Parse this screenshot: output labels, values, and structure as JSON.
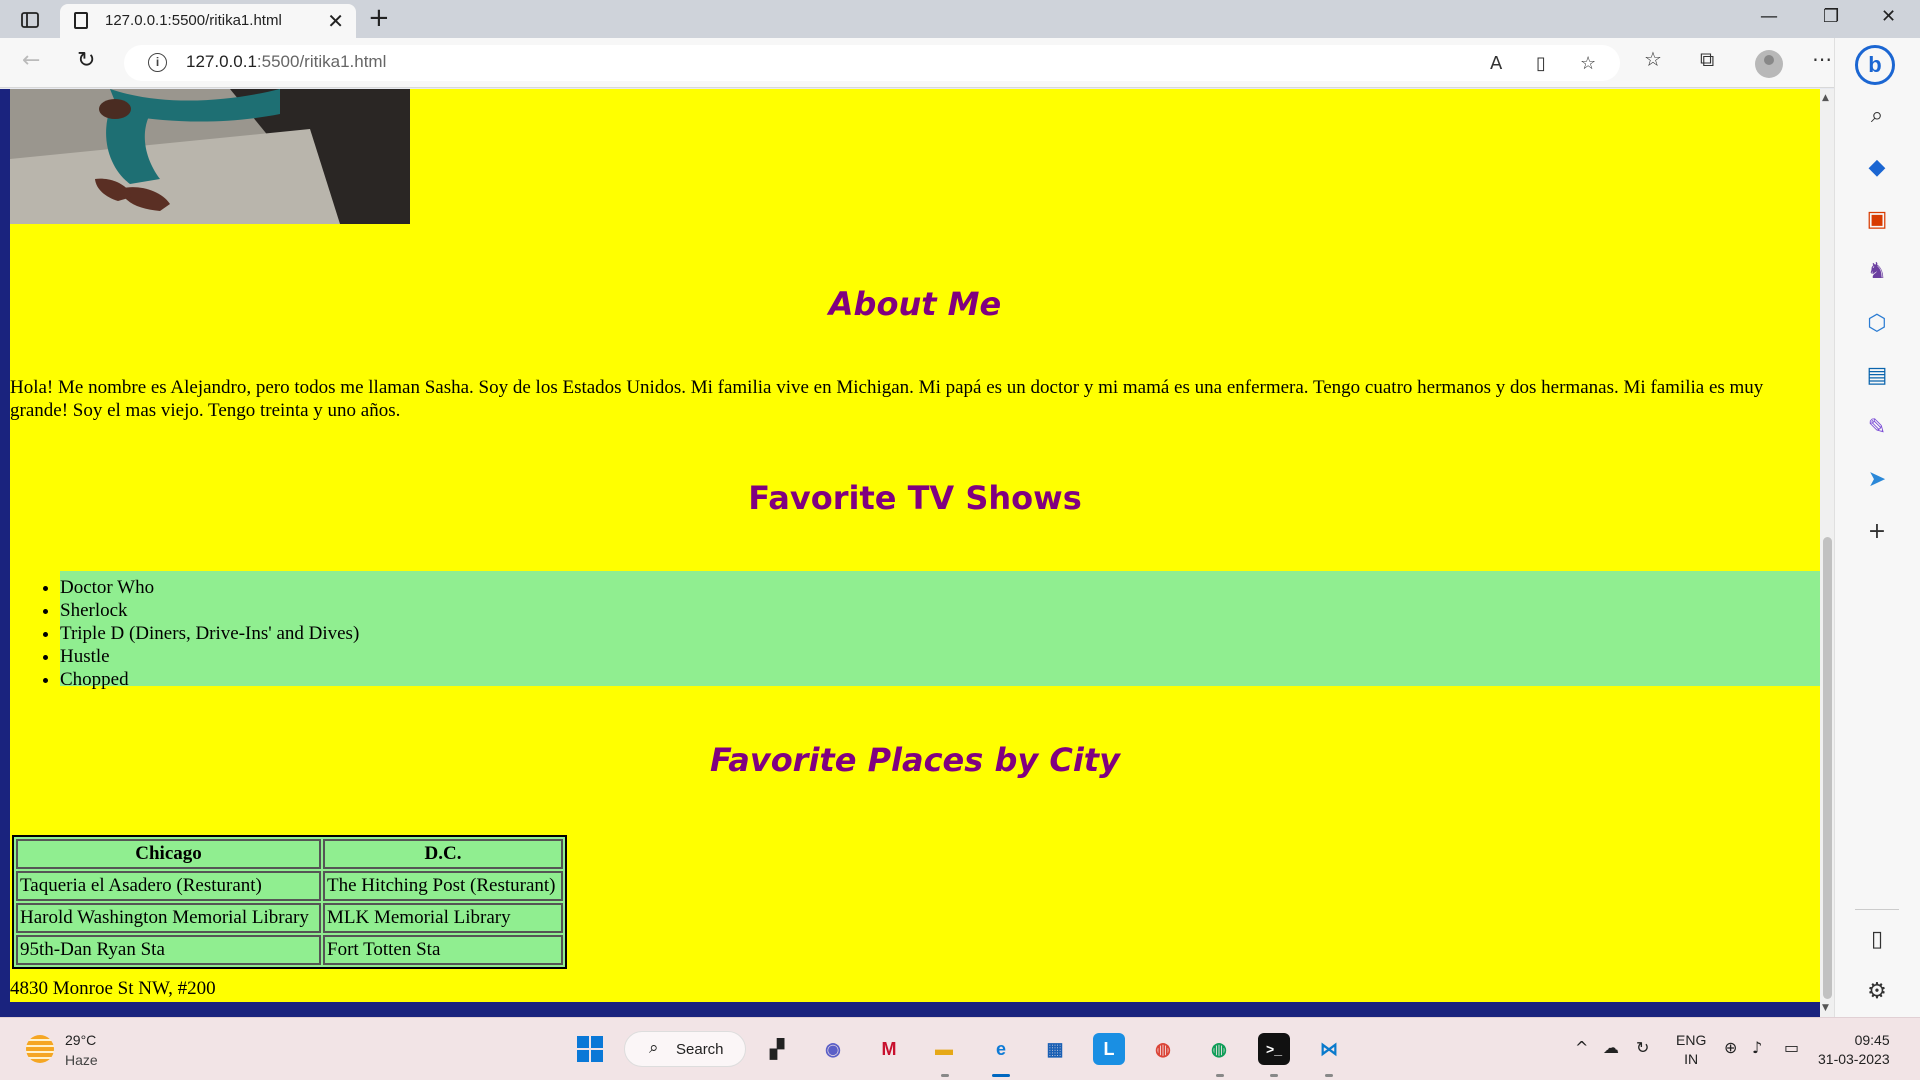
{
  "browser": {
    "tab_title": "127.0.0.1:5500/ritika1.html",
    "tab_close": "✕",
    "new_tab": "+",
    "url_host": "127.0.0.1",
    "url_path": ":5500/ritika1.html",
    "minimize": "—",
    "restore": "❐",
    "close": "✕"
  },
  "page": {
    "about_heading": "About Me",
    "about_text": "Hola! Me nombre es Alejandro, pero todos me llaman Sasha. Soy de los Estados Unidos. Mi familia vive en Michigan. Mi papá es un doctor y mi mamá es una enfermera. Tengo cuatro hermanos y dos hermanas. Mi familia es muy grande! Soy el mas viejo. Tengo treinta y uno años.",
    "shows_heading": "Favorite TV Shows",
    "shows": [
      "Doctor Who",
      "Sherlock",
      "Triple D (Diners, Drive-Ins' and Dives)",
      "Hustle",
      "Chopped"
    ],
    "places_heading": "Favorite Places by City",
    "places_table": {
      "headers": [
        "Chicago",
        "D.C."
      ],
      "rows": [
        [
          "Taqueria el Asadero (Resturant)",
          "The Hitching Post (Resturant)"
        ],
        [
          "Harold Washington Memorial Library",
          "MLK Memorial Library"
        ],
        [
          "95th-Dan Ryan Sta",
          "Fort Totten Sta"
        ]
      ]
    },
    "address": "4830 Monroe St NW, #200"
  },
  "colors": {
    "page_bg": "#ffff00",
    "heading": "#800080",
    "list_bg": "#90ee90",
    "frame_bg": "#1a237e"
  },
  "taskbar": {
    "temperature": "29°C",
    "weather": "Haze",
    "search_label": "Search",
    "lang_1": "ENG",
    "lang_2": "IN",
    "time": "09:45",
    "date": "31-03-2023"
  }
}
